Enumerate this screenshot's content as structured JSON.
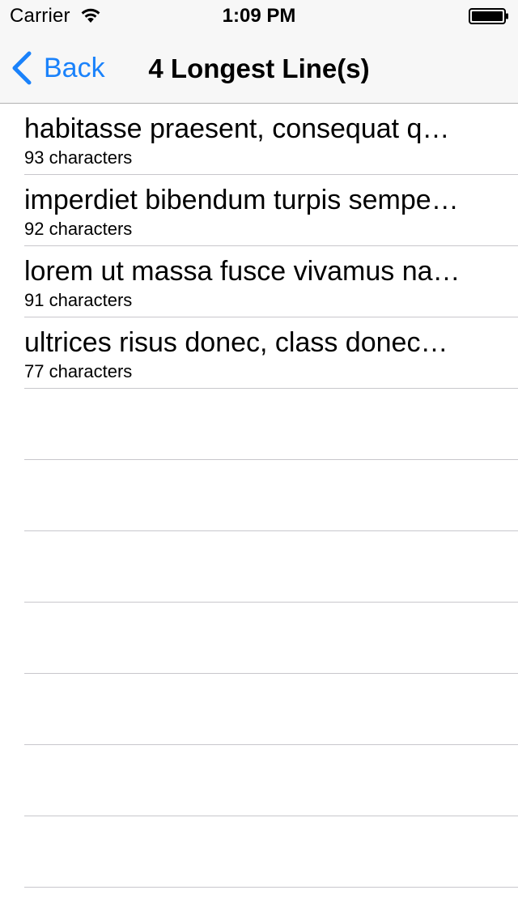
{
  "status_bar": {
    "carrier": "Carrier",
    "time": "1:09 PM",
    "wifi_icon": "wifi-icon",
    "battery_icon": "battery-icon"
  },
  "nav": {
    "back_label": "Back",
    "back_icon": "chevron-left-icon",
    "title": "4 Longest Line(s)",
    "accent_color": "#1a82fb"
  },
  "lines": [
    {
      "text": "habitasse praesent, consequat q…",
      "detail": "93 characters"
    },
    {
      "text": "imperdiet bibendum turpis sempe…",
      "detail": "92 characters"
    },
    {
      "text": "lorem ut massa fusce vivamus na…",
      "detail": "91 characters"
    },
    {
      "text": "ultrices risus donec, class donec…",
      "detail": "77 characters"
    }
  ]
}
